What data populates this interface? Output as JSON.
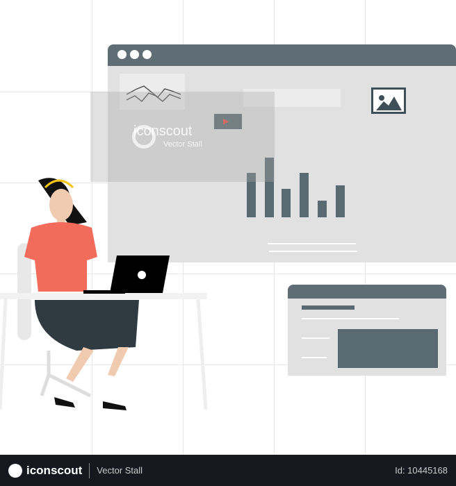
{
  "watermark": {
    "brand": "iconscout",
    "subtitle": "Vector Stall"
  },
  "footer": {
    "brand": "iconscout",
    "author": "Vector Stall",
    "id_label": "Id: 10445168"
  },
  "colors": {
    "window_bar": "#5f6e75",
    "window_body": "#e1e1e1",
    "shirt": "#f26b5b",
    "skirt": "#2f3b40",
    "footer_bg": "#16171f"
  },
  "icons": [
    "browser-dots",
    "line-chart",
    "image-icon",
    "video-play-icon",
    "search-icon",
    "laptop",
    "bar-chart",
    "iconscout-logo"
  ]
}
